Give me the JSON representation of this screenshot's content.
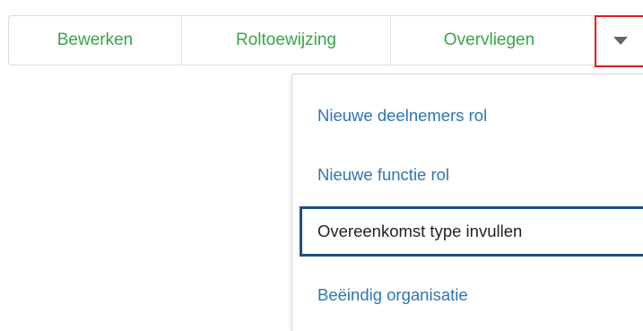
{
  "toolbar": {
    "edit_label": "Bewerken",
    "role_assignment_label": "Roltoewijzing",
    "overfly_label": "Overvliegen",
    "more_icon": "caret-down-icon"
  },
  "dropdown": {
    "items": [
      {
        "label": "Nieuwe deelnemers rol"
      },
      {
        "label": "Nieuwe functie rol"
      },
      {
        "label": "Overeenkomst type invullen"
      },
      {
        "label": "Beëindig organisatie"
      }
    ]
  },
  "colors": {
    "toolbar_text": "#3aa34a",
    "menu_link": "#2f74b8",
    "focus_border": "#1c4f8e",
    "highlight_border": "#e02020"
  }
}
